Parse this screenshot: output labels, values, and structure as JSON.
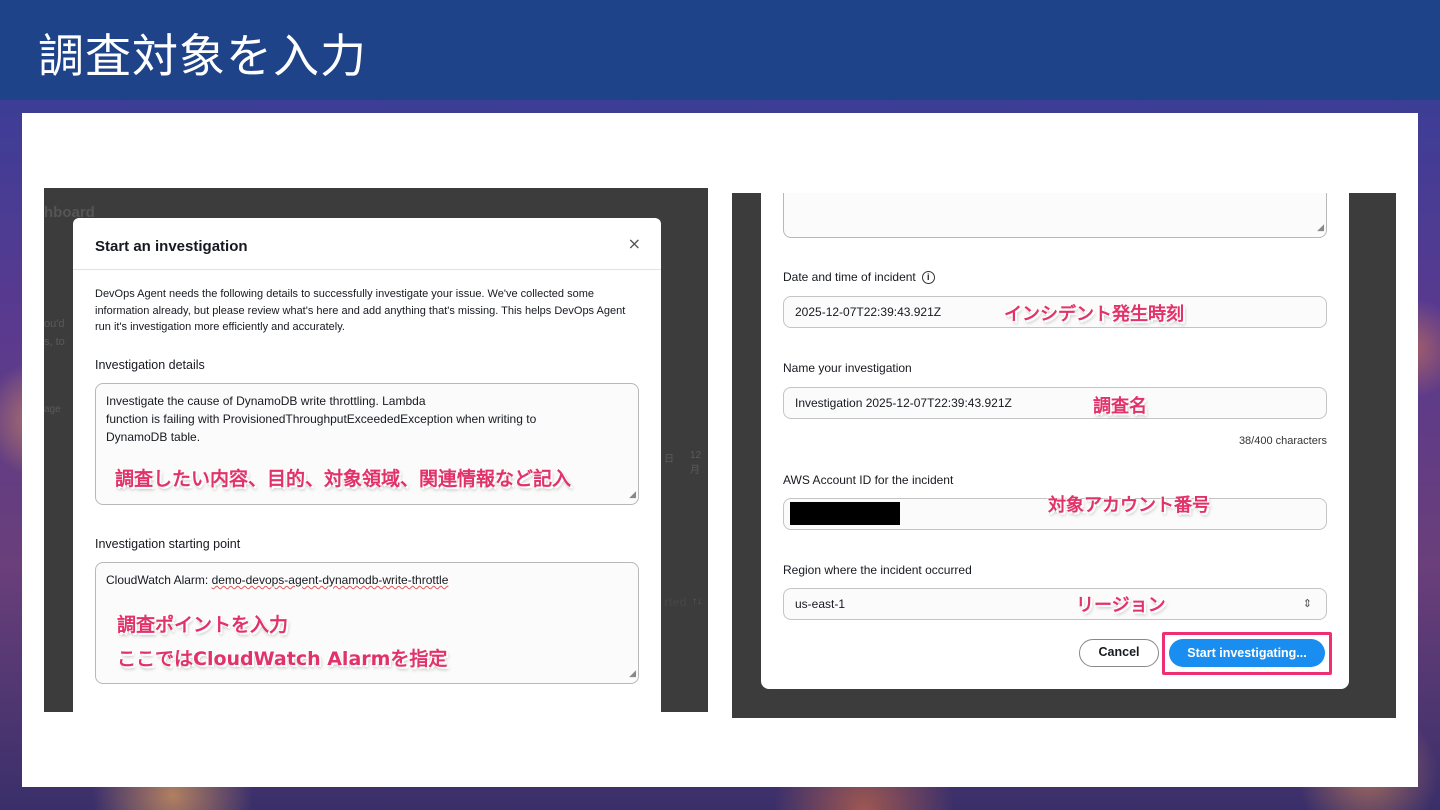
{
  "slide": {
    "title": "調査対象を入力"
  },
  "left": {
    "background_heading": "hboard",
    "background_fragments": [
      "ou'd",
      "s, to",
      "age",
      "日",
      "12月",
      "rted",
      "↑↓"
    ],
    "modal_title": "Start an investigation",
    "close_icon": "×",
    "description": "DevOps Agent needs the following details to successfully investigate your issue. We've collected some information already, but please review what's here and add anything that's missing. This helps DevOps Agent run it's investigation more efficiently and accurately.",
    "details_label": "Investigation details",
    "details_line1": "Investigate the cause of DynamoDB write throttling. Lambda",
    "details_line2": "function is failing with ProvisionedThroughputExceededException when writing to",
    "details_line3": "DynamoDB table.",
    "details_note": "調査したい内容、目的、対象領域、関連情報など記入",
    "starting_label": "Investigation starting point",
    "starting_prefix": "CloudWatch Alarm: ",
    "starting_alarm": "demo-devops-agent-dynamodb-write-throttle",
    "starting_note1": "調査ポイントを入力",
    "starting_note2": "ここではCloudWatch Alarmを指定"
  },
  "right": {
    "datetime_label": "Date and time of incident",
    "datetime_value": "2025-12-07T22:39:43.921Z",
    "datetime_note": "インシデント発生時刻",
    "name_label": "Name your investigation",
    "name_value": "Investigation 2025-12-07T22:39:43.921Z",
    "name_note": "調査名",
    "char_count": "38/400 characters",
    "account_label": "AWS Account ID for the incident",
    "account_note": "対象アカウント番号",
    "region_label": "Region where the incident occurred",
    "region_value": "us-east-1",
    "region_note": "リージョン",
    "cancel_label": "Cancel",
    "start_label": "Start investigating..."
  },
  "colors": {
    "title_bar": "#1e4388",
    "annotation_pink": "#e2326a",
    "primary_button": "#1a8ef0",
    "highlight_border": "#ef2f74"
  }
}
